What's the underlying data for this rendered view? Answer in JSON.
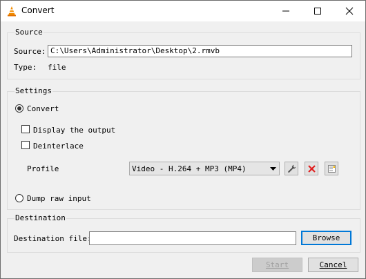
{
  "window": {
    "title": "Convert"
  },
  "source": {
    "group_title": "Source",
    "source_label": "Source:",
    "source_value": "C:\\Users\\Administrator\\Desktop\\2.rmvb",
    "type_label": "Type:",
    "type_value": "file"
  },
  "settings": {
    "group_title": "Settings",
    "convert_label": "Convert",
    "convert_selected": true,
    "display_output_label": "Display the output",
    "display_output_checked": false,
    "deinterlace_label": "Deinterlace",
    "deinterlace_checked": false,
    "profile_label": "Profile",
    "profile_selected": "Video - H.264 + MP3 (MP4)",
    "dump_raw_label": "Dump raw input",
    "dump_raw_selected": false
  },
  "destination": {
    "group_title": "Destination",
    "file_label": "Destination file:",
    "file_value": "",
    "browse_label": "Browse"
  },
  "footer": {
    "start_label": "Start",
    "cancel_label": "Cancel"
  },
  "icons": {
    "app": "vlc-cone-icon",
    "minimize": "minimize-icon",
    "maximize": "maximize-icon",
    "close": "close-icon",
    "edit_profile": "wrench-icon",
    "delete_profile": "red-x-icon",
    "new_profile": "new-profile-icon"
  },
  "colors": {
    "vlc_orange": "#f28c00",
    "delete_red": "#e02020",
    "focus_blue": "#0078d7"
  }
}
